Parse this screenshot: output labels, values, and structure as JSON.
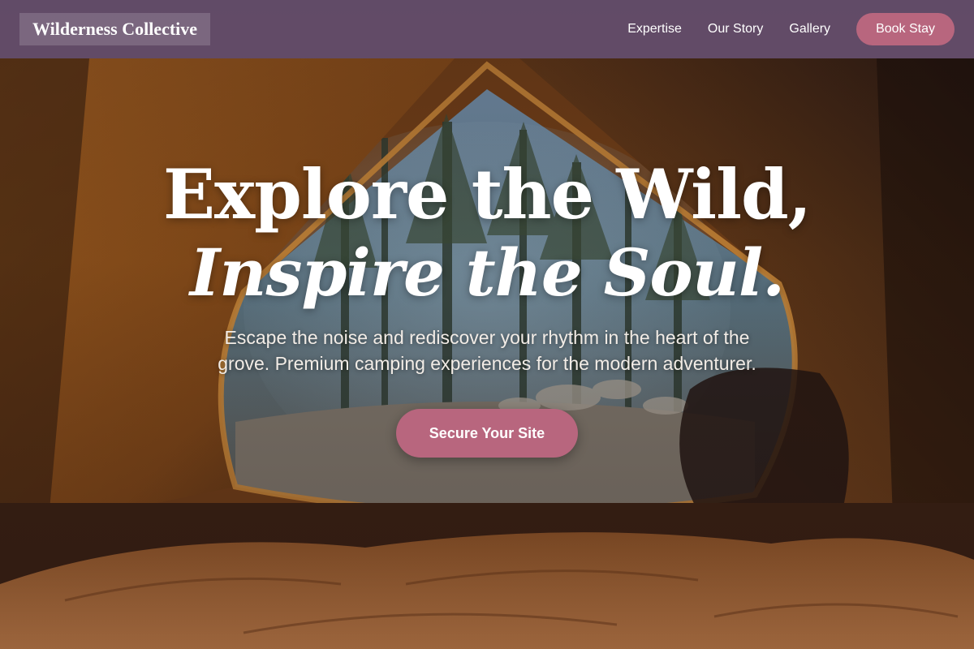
{
  "brand": {
    "name": "Wilderness Collective"
  },
  "nav": {
    "links": [
      {
        "label": "Expertise"
      },
      {
        "label": "Our Story"
      },
      {
        "label": "Gallery"
      }
    ],
    "cta_label": "Book Stay"
  },
  "hero": {
    "headline_line1": "Explore the Wild,",
    "headline_line2": "Inspire the Soul.",
    "subtext": "Escape the noise and rediscover your rhythm in the heart of the grove. Premium camping experiences for the modern adventurer.",
    "cta_label": "Secure Your Site"
  },
  "colors": {
    "nav_background": "#624e6e",
    "accent": "#b8667e",
    "text_light": "#ffffff"
  }
}
